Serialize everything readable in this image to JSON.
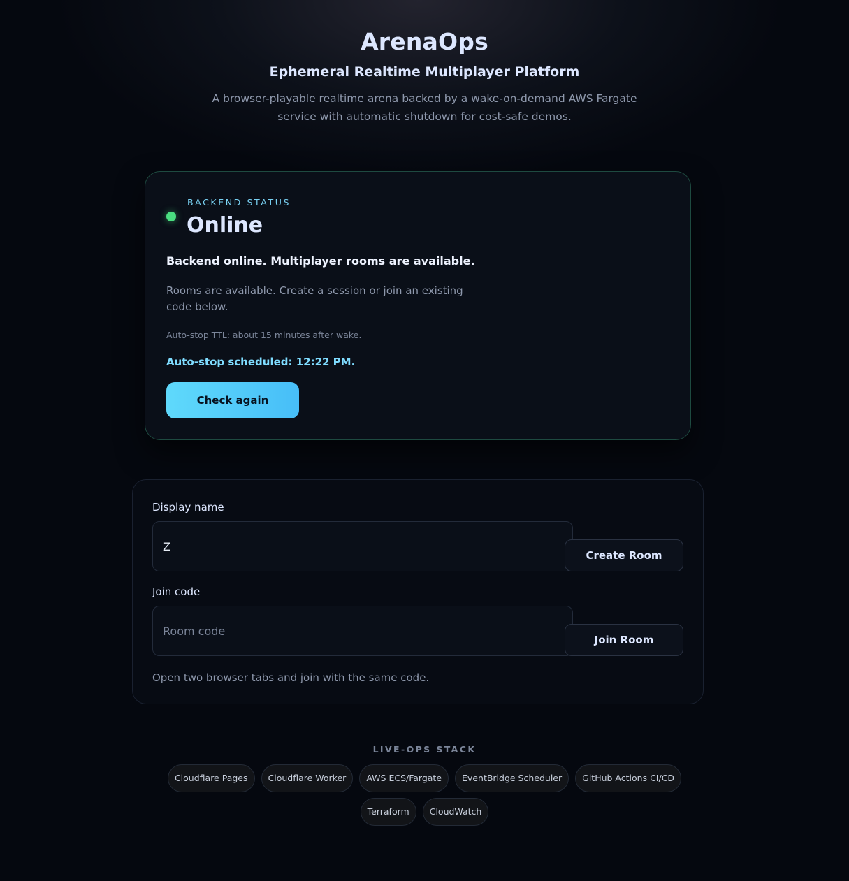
{
  "header": {
    "title": "ArenaOps",
    "subtitle": "Ephemeral Realtime Multiplayer Platform",
    "description": "A browser-playable realtime arena backed by a wake-on-demand AWS Fargate service with automatic shutdown for cost-safe demos."
  },
  "status": {
    "eyebrow": "BACKEND STATUS",
    "value": "Online",
    "indicator_color": "#4ade80",
    "message": "Backend online. Multiplayer rooms are available.",
    "detail": "Rooms are available. Create a session or join an existing code below.",
    "ttl": "Auto-stop TTL: about 15 minutes after wake.",
    "schedule": "Auto-stop scheduled: 12:22 PM.",
    "check_label": "Check again"
  },
  "room": {
    "display_name_label": "Display name",
    "display_name_value": "Z",
    "create_label": "Create Room",
    "join_code_label": "Join code",
    "join_code_value": "",
    "join_code_placeholder": "Room code",
    "join_label": "Join Room",
    "hint": "Open two browser tabs and join with the same code."
  },
  "stack": {
    "title": "LIVE-OPS STACK",
    "chips": [
      "Cloudflare Pages",
      "Cloudflare Worker",
      "AWS ECS/Fargate",
      "EventBridge Scheduler",
      "GitHub Actions CI/CD",
      "Terraform",
      "CloudWatch"
    ]
  },
  "colors": {
    "accent": "#5fd9fb",
    "online": "#4ade80",
    "background": "#05080f"
  }
}
